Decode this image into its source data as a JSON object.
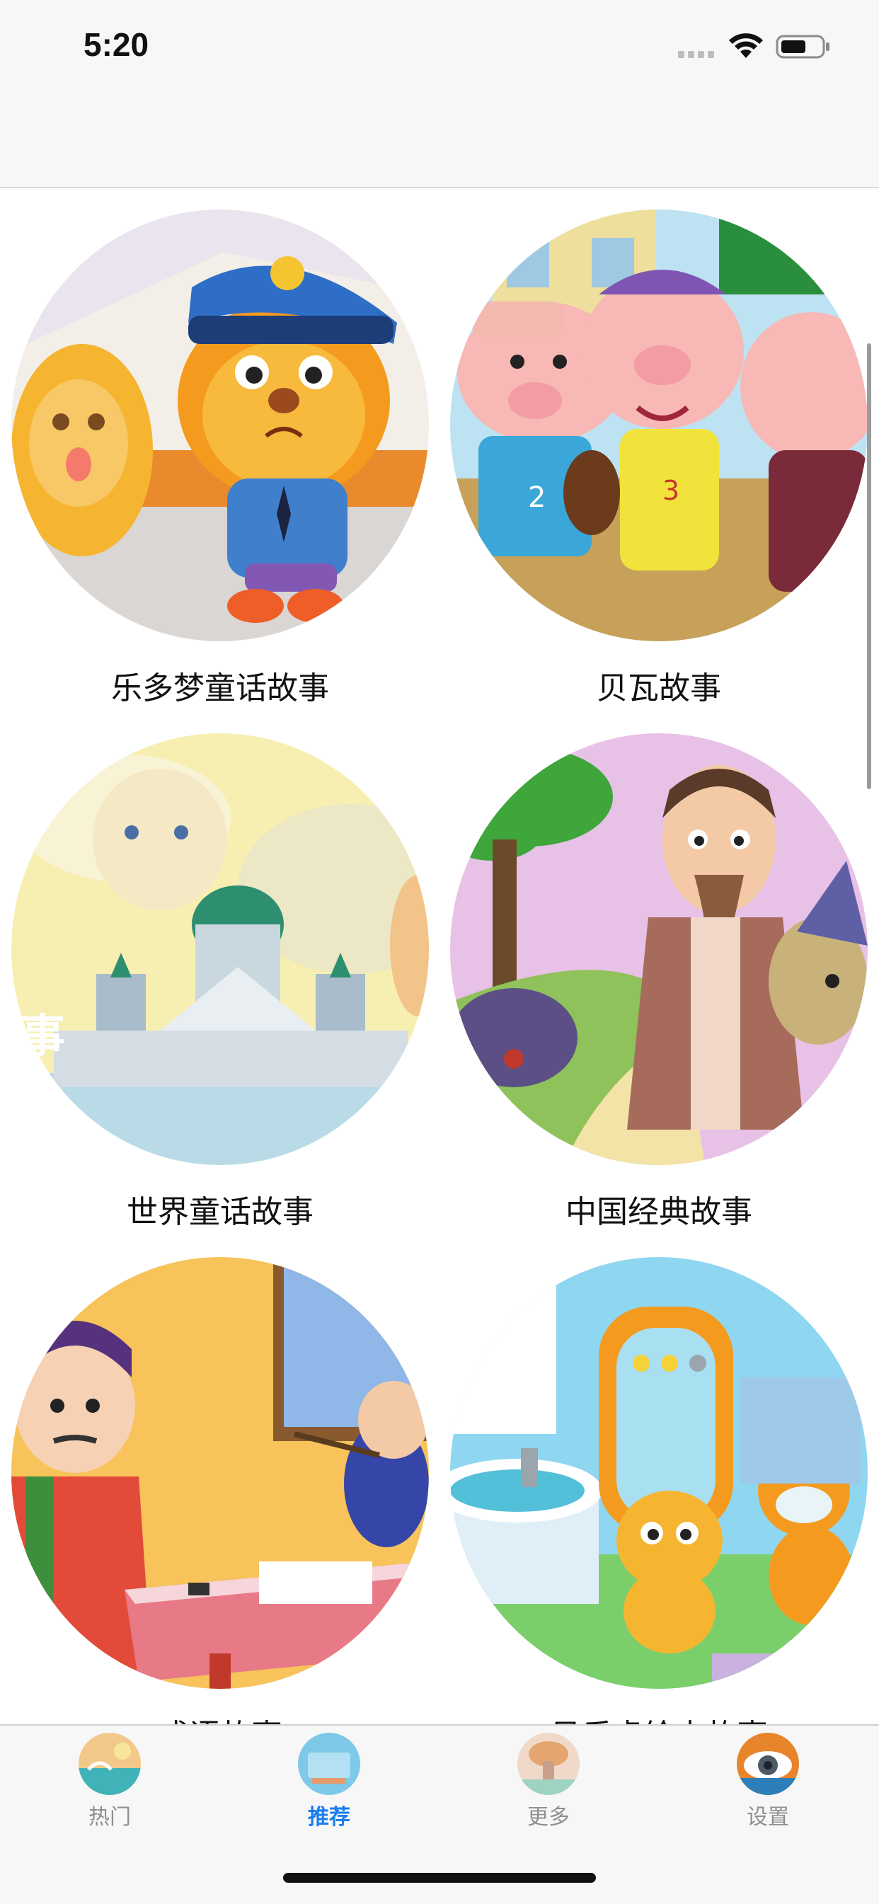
{
  "status_bar": {
    "time": "5:20"
  },
  "stories": [
    {
      "title": "乐多梦童话故事",
      "image": "police-dog-and-cat-illustration"
    },
    {
      "title": "贝瓦故事",
      "image": "three-little-pigs-illustration"
    },
    {
      "title": "世界童话故事",
      "image": "fairy-castle-cat-clouds-illustration"
    },
    {
      "title": "中国经典故事",
      "image": "chinese-sage-illustration"
    },
    {
      "title": "成语故事",
      "image": "ancient-scholars-illustration"
    },
    {
      "title": "贝乐虎绘本故事",
      "image": "tiger-cubs-bathroom-illustration"
    }
  ],
  "tabs": [
    {
      "label": "热门",
      "icon": "hot-tab-icon",
      "active": false
    },
    {
      "label": "推荐",
      "icon": "recommend-tab-icon",
      "active": true
    },
    {
      "label": "更多",
      "icon": "more-tab-icon",
      "active": false
    },
    {
      "label": "设置",
      "icon": "settings-tab-icon",
      "active": false
    }
  ],
  "colors": {
    "active_tab": "#1a7df0",
    "inactive_tab": "#8e8e93",
    "background": "#ffffff"
  }
}
